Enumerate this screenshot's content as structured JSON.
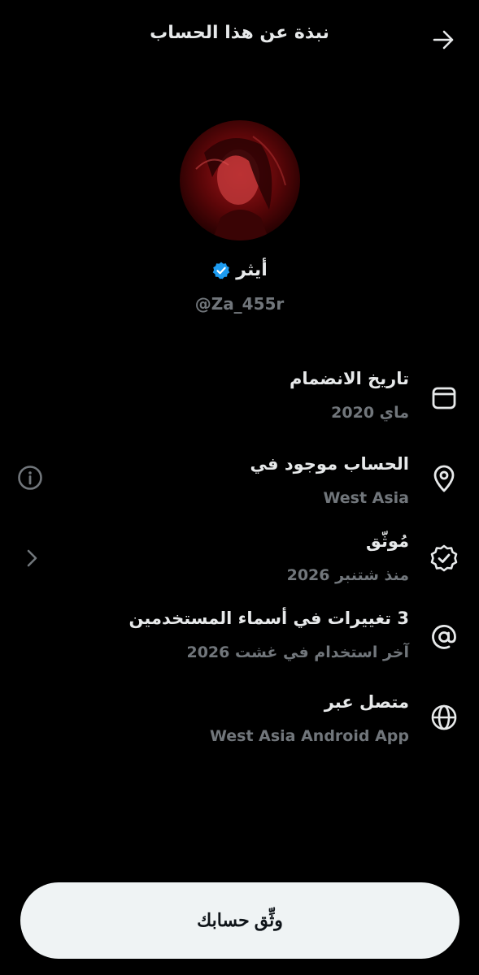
{
  "header": {
    "title": "نبذة عن هذا الحساب",
    "back_icon": "arrow-right-icon"
  },
  "profile": {
    "display_name": "أيثر",
    "handle": "@Za_455r",
    "verified": true,
    "verified_color": "#1d9bf0",
    "avatar_icon": "profile-photo"
  },
  "info": [
    {
      "title": "تاريخ الانضمام",
      "value": "ماي 2020",
      "icon": "calendar-icon"
    },
    {
      "title": "الحساب موجود في",
      "value": "West Asia",
      "icon": "location-pin-icon"
    },
    {
      "title": "مُوثّق",
      "value": "منذ شتنبر 2026",
      "icon": "verified-badge-icon"
    },
    {
      "title": "3 تغييرات في أسماء المستخدمين",
      "value": "آخر استخدام في غشت 2026",
      "icon": "at-sign-icon"
    },
    {
      "title": "متصل عبر",
      "value": "West Asia Android App",
      "icon": "globe-icon"
    }
  ],
  "side_icons": {
    "info": "info-circle-icon",
    "chevron": "chevron-left-icon"
  },
  "cta": {
    "label": "وثِّق حسابك"
  },
  "colors": {
    "background": "#000000",
    "text": "#e7e9ea",
    "muted": "#71767b",
    "accent": "#1d9bf0",
    "button_bg": "#eff3f4"
  }
}
